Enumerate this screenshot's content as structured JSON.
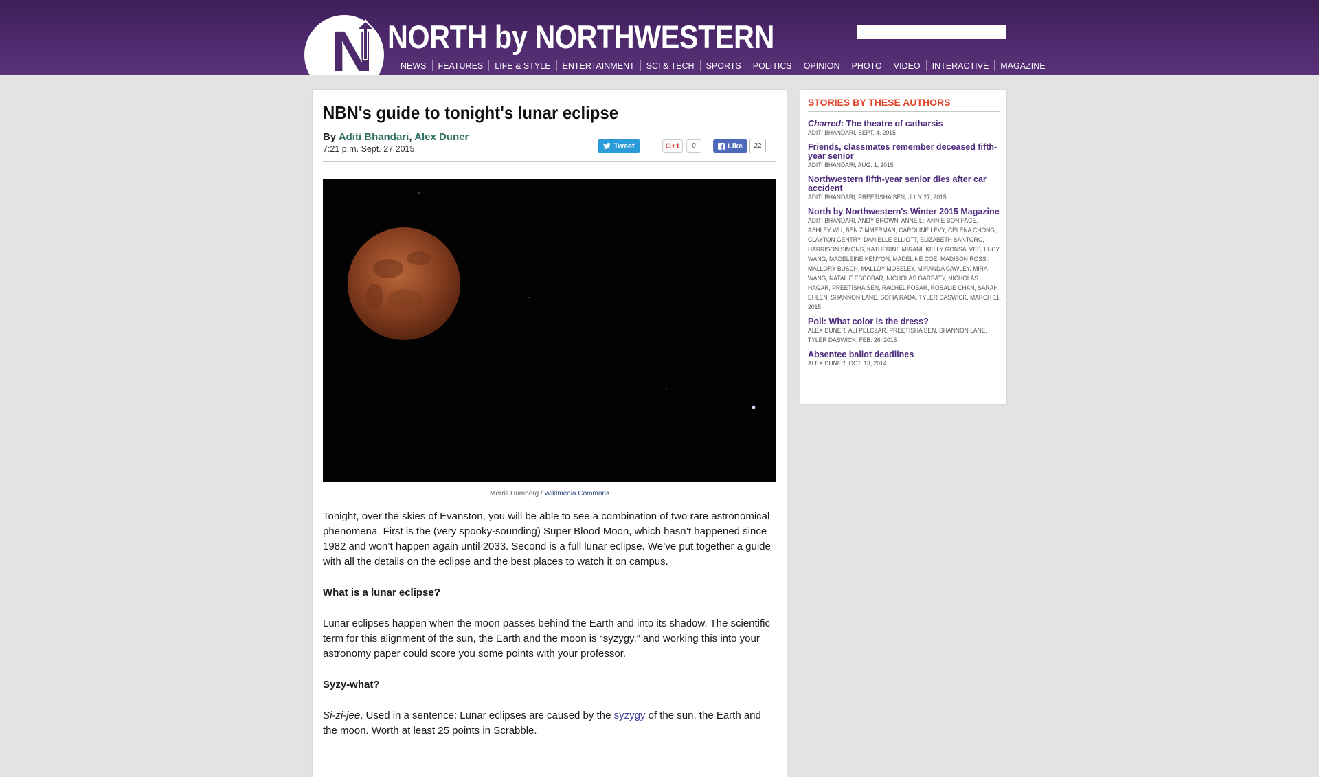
{
  "site": {
    "logo_letter": "N",
    "title": "NORTH by NORTHWESTERN",
    "search": {
      "value": "",
      "placeholder": ""
    },
    "nav": [
      "NEWS",
      "FEATURES",
      "LIFE & STYLE",
      "ENTERTAINMENT",
      "SCI & TECH",
      "SPORTS",
      "POLITICS",
      "OPINION",
      "PHOTO",
      "VIDEO",
      "INTERACTIVE",
      "MAGAZINE"
    ],
    "colors": {
      "header": "#4f2a6e",
      "sidebar_heading": "#e2452b",
      "link": "#4c2a7c"
    }
  },
  "article": {
    "title": "NBN's guide to tonight's lunar eclipse",
    "byline_prefix": "By",
    "authors": [
      "Aditi Bhandari",
      "Alex Duner"
    ],
    "author_separator": ",",
    "timestamp": "7:21 p.m. Sept. 27 2015",
    "share": {
      "tweet_label": "Tweet",
      "gplus_label": "G+1",
      "gplus_count": "0",
      "fb_label": "Like",
      "fb_count": "22"
    },
    "photo_credit": "Merrill Humberg",
    "photo_credit_sep": "/",
    "photo_source": "Wikimedia Commons",
    "paragraphs": {
      "p1": "Tonight, over the skies of Evanston, you will be able to see a combination of two rare astronomical phenomena. First is the (very spooky-sounding) Super Blood Moon, which hasn’t happened since 1982 and won’t happen again until 2033. Second is a full lunar eclipse. We’ve put together a guide with all the details on the eclipse and the best places to watch it on campus.",
      "h1": "What is a lunar eclipse?",
      "p2": "Lunar eclipses happen when the moon passes behind the Earth and into its shadow. The scientific term for this alignment of the sun, the Earth and the moon is “syzygy,” and working this into your astronomy paper could score you some points with your professor.",
      "h2": "Syzy-what?",
      "p3_italic": "Si-zi-jee",
      "p3_a": ". Used in a sentence: Lunar eclipses are caused by the ",
      "p3_link": "syzygy",
      "p3_b": " of the sun, the Earth and the moon. Worth at least 25 points in Scrabble."
    }
  },
  "sidebar": {
    "heading": "STORIES BY THESE AUTHORS",
    "stories": [
      {
        "title_italic": "Charred",
        "title": ": The theatre of catharsis",
        "meta": "ADITI BHANDARI, SEPT. 4, 2015"
      },
      {
        "title_italic": "",
        "title": "Friends, classmates remember deceased fifth-year senior",
        "meta": "ADITI BHANDARI, AUG. 1, 2015"
      },
      {
        "title_italic": "",
        "title": "Northwestern fifth-year senior dies after car accident",
        "meta": "ADITI BHANDARI, PREETISHA SEN, JULY 27, 2015"
      },
      {
        "title_italic": "",
        "title": "North by Northwestern's Winter 2015 Magazine",
        "meta": "ADITI BHANDARI, ANDY BROWN, ANNE LI, ANNIE BONIFACE, ASHLEY WU, BEN ZIMMERMAN, CAROLINE LEVY, CELENA CHONG, CLAYTON GENTRY, DANIELLE ELLIOTT, ELIZABETH SANTORO, HARRISON SIMONS, KATHERINE MIRANI, KELLY GONSALVES, LUCY WANG, MADELEINE KENYON, MADELINE COE, MADISON ROSSI, MALLORY BUSCH, MALLOY MOSELEY, MIRANDA CAWLEY, MIRA WANG, NATALIE ESCOBAR, NICHOLAS GARBATY, NICHOLAS HAGAR, PREETISHA SEN, RACHEL FOBAR, ROSALIE CHAN, SARAH EHLEN, SHANNON LANE, SOFIA RADA, TYLER DASWICK, MARCH 11, 2015"
      },
      {
        "title_italic": "",
        "title": "Poll: What color is the dress?",
        "meta": "ALEX DUNER, ALI PELCZAR, PREETISHA SEN, SHANNON LANE, TYLER DASWICK, FEB. 26, 2015"
      },
      {
        "title_italic": "",
        "title": "Absentee ballot deadlines",
        "meta": "ALEX DUNER, OCT. 13, 2014"
      }
    ]
  }
}
